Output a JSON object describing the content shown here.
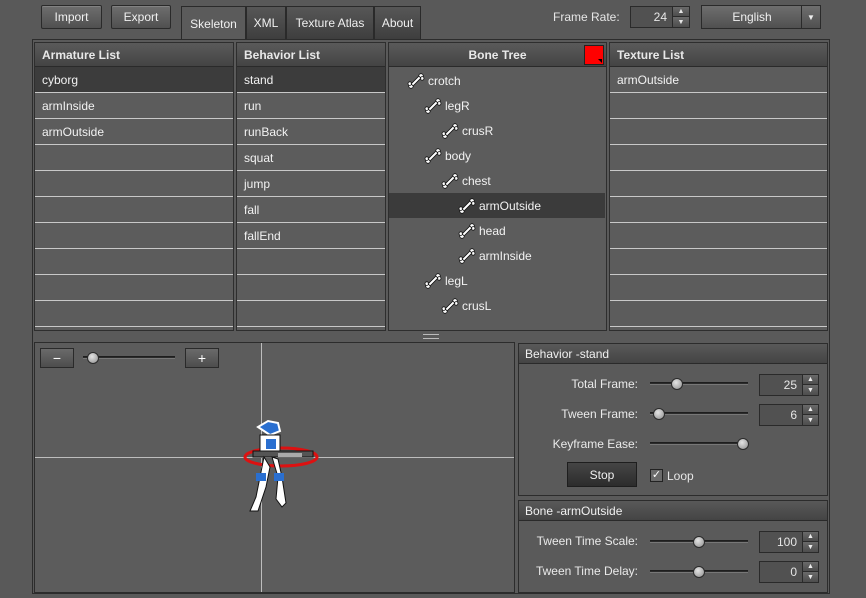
{
  "toolbar": {
    "import_label": "Import",
    "export_label": "Export"
  },
  "tabs": [
    {
      "label": "Skeleton",
      "active": true
    },
    {
      "label": "XML",
      "active": false
    },
    {
      "label": "Texture Atlas",
      "active": false
    },
    {
      "label": "About",
      "active": false
    }
  ],
  "frame_rate": {
    "label": "Frame Rate:",
    "value": "24"
  },
  "language": {
    "selected": "English"
  },
  "armature_list": {
    "header": "Armature List",
    "items": [
      "cyborg",
      "armInside",
      "armOutside"
    ],
    "selected": "cyborg"
  },
  "behavior_list": {
    "header": "Behavior List",
    "items": [
      "stand",
      "run",
      "runBack",
      "squat",
      "jump",
      "fall",
      "fallEnd"
    ],
    "selected": "stand"
  },
  "bone_tree": {
    "header": "Bone Tree",
    "color_swatch": "#ff0000",
    "nodes": [
      {
        "label": "crotch",
        "depth": 0
      },
      {
        "label": "legR",
        "depth": 1
      },
      {
        "label": "crusR",
        "depth": 2
      },
      {
        "label": "body",
        "depth": 1
      },
      {
        "label": "chest",
        "depth": 2
      },
      {
        "label": "armOutside",
        "depth": 3,
        "selected": true
      },
      {
        "label": "head",
        "depth": 3
      },
      {
        "label": "armInside",
        "depth": 3
      },
      {
        "label": "legL",
        "depth": 1
      },
      {
        "label": "crusL",
        "depth": 2
      }
    ]
  },
  "texture_list": {
    "header": "Texture List",
    "items": [
      "armOutside"
    ]
  },
  "viewport": {
    "zoom_out_label": "−",
    "zoom_in_label": "+",
    "zoom_level": 0.1
  },
  "behavior_panel": {
    "title": "Behavior -stand",
    "total_frame": {
      "label": "Total Frame:",
      "value": "25",
      "slider": 0.25
    },
    "tween_frame": {
      "label": "Tween Frame:",
      "value": "6",
      "slider": 0.05
    },
    "keyframe_ease": {
      "label": "Keyframe Ease:",
      "slider": 0.97
    },
    "stop_label": "Stop",
    "loop_label": "Loop",
    "loop_checked": true
  },
  "bone_panel": {
    "title": "Bone -armOutside",
    "tween_time_scale": {
      "label": "Tween Time Scale:",
      "value": "100",
      "slider": 0.5
    },
    "tween_time_delay": {
      "label": "Tween Time Delay:",
      "value": "0",
      "slider": 0.5
    }
  }
}
